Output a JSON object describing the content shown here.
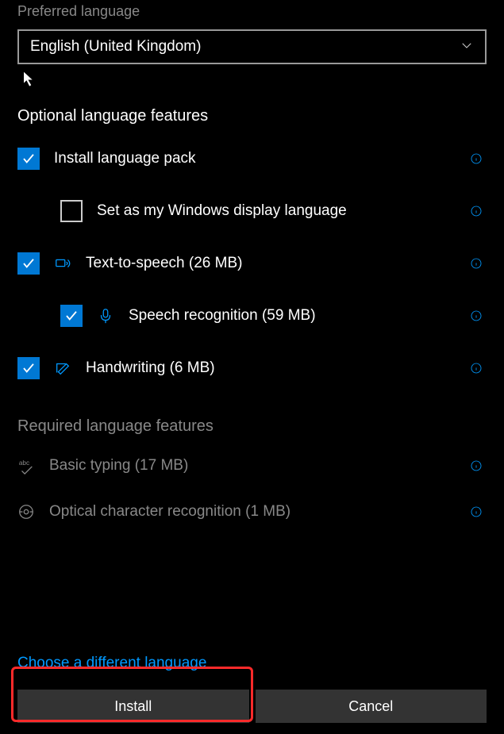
{
  "preferred": {
    "label": "Preferred language",
    "value": "English (United Kingdom)"
  },
  "optional": {
    "title": "Optional language features",
    "install_pack": "Install language pack",
    "display_lang": "Set as my Windows display language",
    "tts": "Text-to-speech (26 MB)",
    "speech_rec": "Speech recognition (59 MB)",
    "handwriting": "Handwriting (6 MB)"
  },
  "required": {
    "title": "Required language features",
    "basic_typing": "Basic typing (17 MB)",
    "ocr": "Optical character recognition (1 MB)"
  },
  "footer": {
    "choose_diff": "Choose a different language",
    "install": "Install",
    "cancel": "Cancel"
  }
}
